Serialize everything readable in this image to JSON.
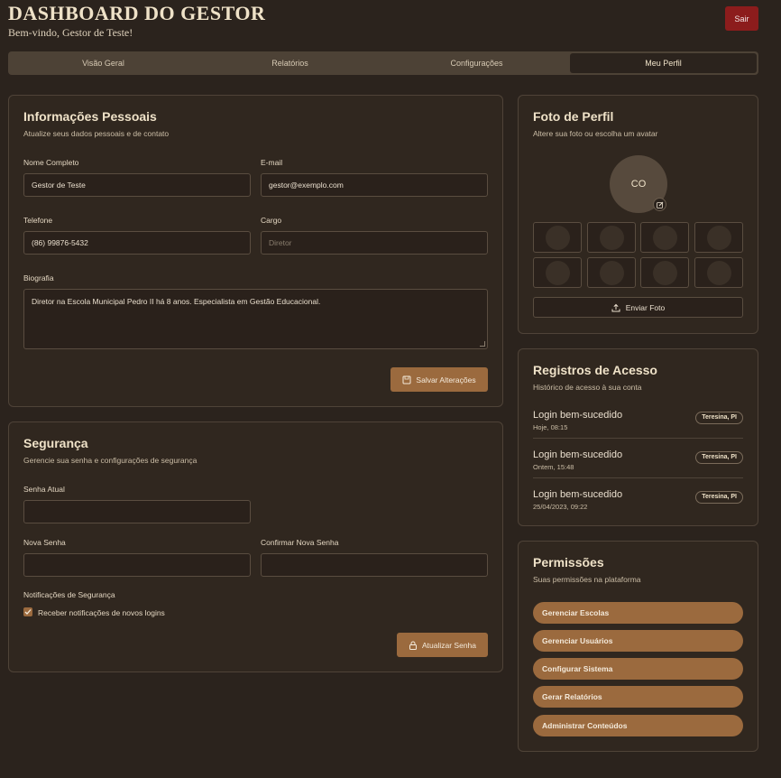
{
  "header": {
    "title": "DASHBOARD DO GESTOR",
    "subtitle": "Bem-vindo, Gestor de Teste!",
    "logout_label": "Sair"
  },
  "tabs": [
    {
      "label": "Visão Geral"
    },
    {
      "label": "Relatórios"
    },
    {
      "label": "Configurações"
    },
    {
      "label": "Meu Perfil"
    }
  ],
  "personal": {
    "title": "Informações Pessoais",
    "subtitle": "Atualize seus dados pessoais e de contato",
    "name_label": "Nome Completo",
    "name_value": "Gestor de Teste",
    "email_label": "E-mail",
    "email_value": "gestor@exemplo.com",
    "phone_label": "Telefone",
    "phone_value": "(86) 99876-5432",
    "role_label": "Cargo",
    "role_value": "Diretor",
    "bio_label": "Biografia",
    "bio_value": "Diretor na Escola Municipal Pedro II há 8 anos. Especialista em Gestão Educacional.",
    "save_label": "Salvar Alterações"
  },
  "security": {
    "title": "Segurança",
    "subtitle": "Gerencie sua senha e configurações de segurança",
    "current_label": "Senha Atual",
    "new_label": "Nova Senha",
    "confirm_label": "Confirmar Nova Senha",
    "notifications_label": "Notificações de Segurança",
    "checkbox_label": "Receber notificações de novos logins",
    "checkbox_checked": true,
    "update_label": "Atualizar Senha"
  },
  "photo": {
    "title": "Foto de Perfil",
    "subtitle": "Altere sua foto ou escolha um avatar",
    "initials": "CO",
    "upload_label": "Enviar Foto"
  },
  "access": {
    "title": "Registros de Acesso",
    "subtitle": "Histórico de acesso à sua conta",
    "items": [
      {
        "title": "Login bem-sucedido",
        "time": "Hoje, 08:15",
        "location": "Teresina, PI"
      },
      {
        "title": "Login bem-sucedido",
        "time": "Ontem, 15:48",
        "location": "Teresina, PI"
      },
      {
        "title": "Login bem-sucedido",
        "time": "25/04/2023, 09:22",
        "location": "Teresina, PI"
      }
    ]
  },
  "permissions": {
    "title": "Permissões",
    "subtitle": "Suas permissões na plataforma",
    "items": [
      {
        "label": "Gerenciar Escolas"
      },
      {
        "label": "Gerenciar Usuários"
      },
      {
        "label": "Configurar Sistema"
      },
      {
        "label": "Gerar Relatórios"
      },
      {
        "label": "Administrar Conteúdos"
      }
    ]
  },
  "colors": {
    "background": "#2b231d",
    "accent": "#9b6a3e",
    "danger": "#8c1c1c"
  }
}
